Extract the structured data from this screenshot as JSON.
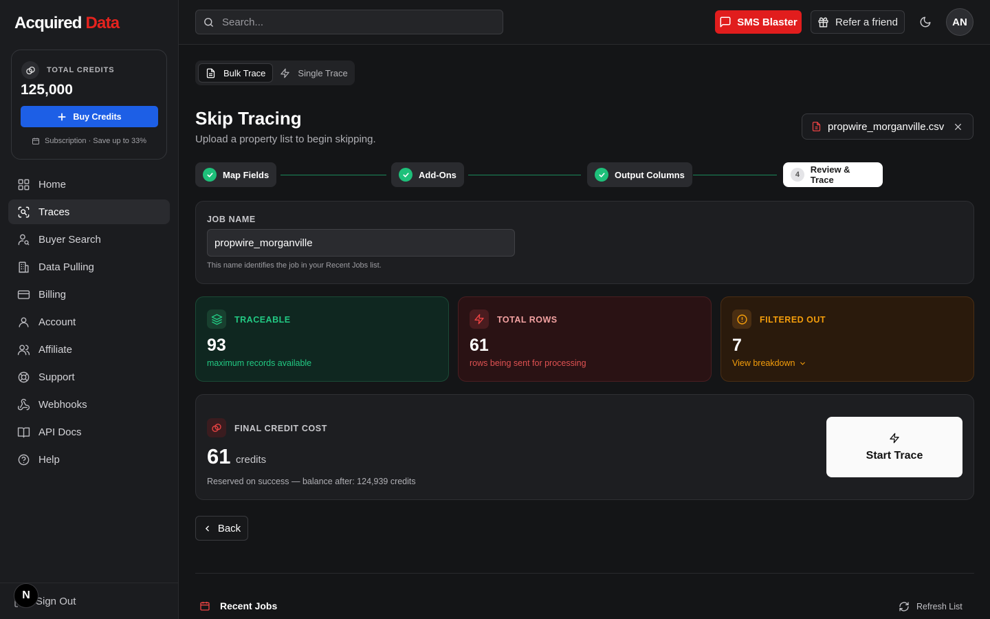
{
  "brand": {
    "name_main": "Acquired",
    "name_accent": "Data",
    "accent_color": "#e5231e"
  },
  "credits": {
    "label": "TOTAL CREDITS",
    "value": "125,000",
    "buy_label": "Buy Credits",
    "subscription_note": "Subscription · Save up to 33%"
  },
  "sidebar": {
    "items": [
      {
        "label": "Home",
        "icon": "grid-icon"
      },
      {
        "label": "Traces",
        "icon": "scan-icon",
        "active": true
      },
      {
        "label": "Buyer Search",
        "icon": "user-search-icon"
      },
      {
        "label": "Data Pulling",
        "icon": "building-icon"
      },
      {
        "label": "Billing",
        "icon": "credit-card-icon"
      },
      {
        "label": "Account",
        "icon": "user-icon"
      },
      {
        "label": "Affiliate",
        "icon": "users-icon"
      },
      {
        "label": "Support",
        "icon": "lifebuoy-icon"
      },
      {
        "label": "Webhooks",
        "icon": "webhook-icon"
      },
      {
        "label": "API Docs",
        "icon": "book-icon"
      },
      {
        "label": "Help",
        "icon": "help-circle-icon"
      }
    ],
    "sign_out": "Sign Out",
    "badge": "N"
  },
  "topbar": {
    "search_placeholder": "Search...",
    "sms_label": "SMS Blaster",
    "refer_label": "Refer a friend",
    "avatar_initials": "AN"
  },
  "tabs": {
    "bulk": "Bulk Trace",
    "single": "Single Trace"
  },
  "page": {
    "title": "Skip Tracing",
    "subtitle": "Upload a property list to begin skipping.",
    "file_name": "propwire_morganville.csv"
  },
  "steps": [
    {
      "label": "Map Fields",
      "done": true
    },
    {
      "label": "Add-Ons",
      "done": true
    },
    {
      "label": "Output Columns",
      "done": true
    },
    {
      "label": "Review & Trace",
      "number": "4",
      "current": true
    }
  ],
  "job": {
    "label": "JOB NAME",
    "value": "propwire_morganville",
    "help": "This name identifies the job in your Recent Jobs list."
  },
  "stats": {
    "traceable": {
      "label": "TRACEABLE",
      "value": "93",
      "desc": "maximum records available",
      "color": "#22c983"
    },
    "total_rows": {
      "label": "TOTAL ROWS",
      "value": "61",
      "desc": "rows being sent for processing",
      "color": "#ef4444"
    },
    "filtered": {
      "label": "FILTERED OUT",
      "value": "7",
      "desc": "View breakdown",
      "color": "#f59e0b"
    }
  },
  "cost": {
    "label": "FINAL CREDIT COST",
    "value": "61",
    "unit": "credits",
    "note": "Reserved on success — balance after: 124,939 credits",
    "start_label": "Start Trace"
  },
  "back_label": "Back",
  "recent": {
    "title": "Recent Jobs",
    "refresh": "Refresh List"
  }
}
